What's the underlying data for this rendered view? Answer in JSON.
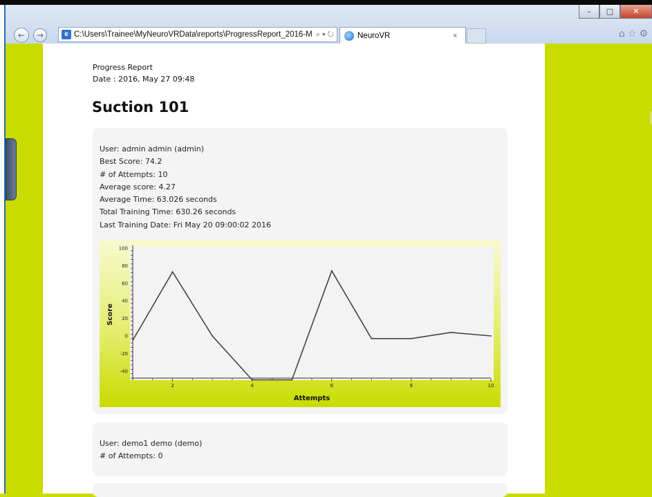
{
  "browser": {
    "url": "C:\\Users\\Trainee\\MyNeuroVRData\\reports\\ProgressReport_2016-M:",
    "addr_tools": "⌕ ▾ ↻",
    "tab_title": "NeuroVR",
    "tab_close": "×",
    "back": "←",
    "forward": "→",
    "minimize": "–",
    "maximize": "□",
    "close": "✕",
    "right_icons": "⌂☆⚙",
    "page_icon": "e"
  },
  "report": {
    "header_line1": "Progress Report",
    "header_line2": "Date : 2016, May 27 09:48",
    "title": "Suction 101"
  },
  "users": [
    {
      "lines": [
        "User: admin admin (admin)",
        "Best Score: 74.2",
        "# of Attempts: 10",
        "Average score: 4.27",
        "Average Time: 63.026 seconds",
        "Total Training Time: 630.26 seconds",
        "Last Training Date: Fri May 20 09:00:02 2016"
      ]
    },
    {
      "lines": [
        "User: demo1 demo (demo)",
        "# of Attempts: 0"
      ]
    }
  ],
  "chart_data": {
    "type": "line",
    "x": [
      1,
      2,
      3,
      4,
      5,
      6,
      7,
      8,
      9,
      10
    ],
    "values": [
      -5,
      73,
      0,
      -50,
      -50,
      74.2,
      -3,
      -3,
      4,
      0
    ],
    "xlabel": "Attempts",
    "ylabel": "Score",
    "xlim": [
      1,
      10
    ],
    "ylim": [
      -48,
      100
    ],
    "yticks": [
      100,
      80,
      60,
      40,
      20,
      0,
      -20,
      -40
    ],
    "xticks": [
      2,
      4,
      6,
      8,
      10
    ],
    "grid": false,
    "line_color": "#444444"
  }
}
